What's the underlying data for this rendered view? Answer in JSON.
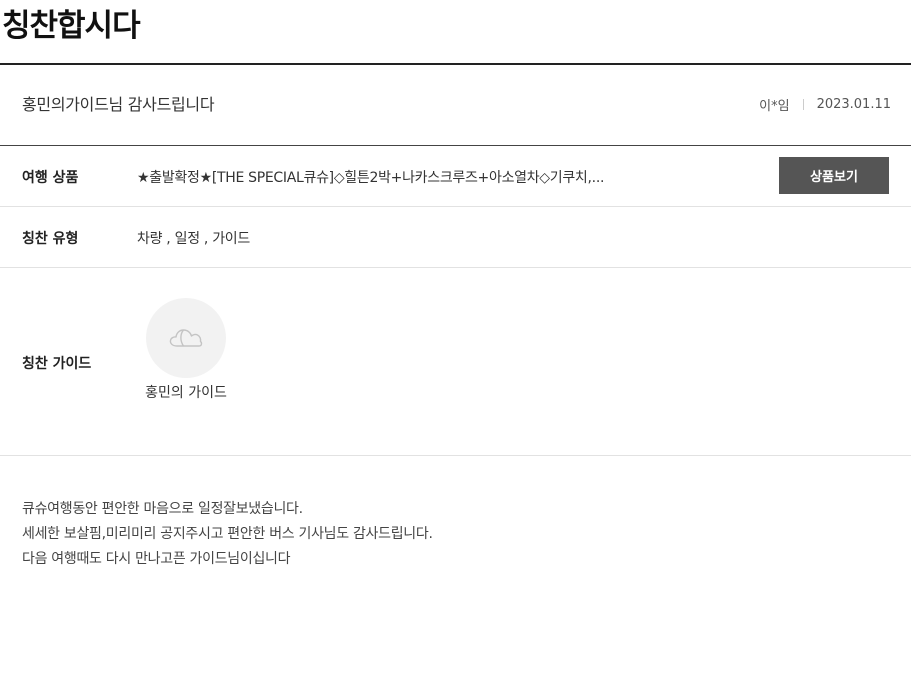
{
  "page": {
    "title": "칭찬합시다"
  },
  "post": {
    "subject": "홍민의가이드님 감사드립니다",
    "author": "이*임",
    "date": "2023.01.11"
  },
  "product": {
    "label": "여행 상품",
    "name": "★출발확정★[THE SPECIAL큐슈]◇힐튼2박+나카스크루즈+아소열차◇기쿠치,...",
    "button_label": "상품보기"
  },
  "praise_type": {
    "label": "칭찬 유형",
    "value": "차량 , 일정 , 가이드"
  },
  "praise_guide": {
    "label": "칭찬 가이드",
    "name": "홍민의 가이드",
    "avatar_icon": "cloud-placeholder-icon"
  },
  "content": {
    "lines": [
      "큐슈여행동안 편안한 마음으로 일정잘보냈습니다.",
      "세세한 보살핌,미리미리 공지주시고 편안한 버스 기사님도 감사드립니다.",
      "다음 여행때도 다시 만나고픈 가이드님이십니다"
    ]
  },
  "colors": {
    "button_bg": "#555555",
    "title_rule": "#222222",
    "row_border": "#e2e2e2",
    "avatar_bg": "#f2f2f2"
  }
}
